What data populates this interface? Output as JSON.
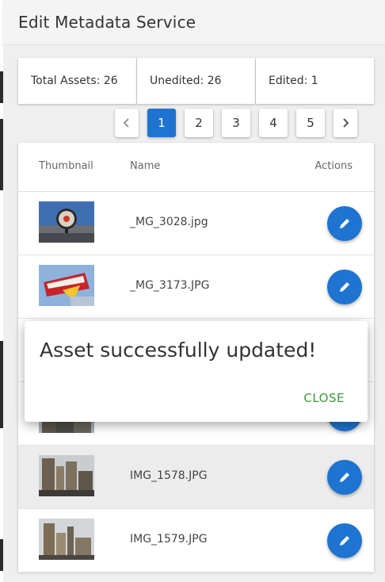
{
  "window": {
    "title": "Edit Metadata Service"
  },
  "stats": {
    "total": "Total Assets: 26",
    "unedited": "Unedited: 26",
    "edited": "Edited: 1"
  },
  "pagination": {
    "pages": [
      "1",
      "2",
      "3",
      "4",
      "5"
    ],
    "active": "1",
    "prev_icon": "chevron-left-icon",
    "next_icon": "chevron-right-icon"
  },
  "table": {
    "columns": {
      "thumbnail": "Thumbnail",
      "name": "Name",
      "actions": "Actions"
    },
    "rows": [
      {
        "name": "_MG_3028.jpg",
        "thumbnail": "clock-photo"
      },
      {
        "name": "_MG_3173.JPG",
        "thumbnail": "in-n-out-sign-photo"
      },
      {
        "name": "",
        "thumbnail": "city-photo"
      },
      {
        "name": "",
        "thumbnail": "city-photo"
      },
      {
        "name": "IMG_1578.JPG",
        "thumbnail": "city-photo"
      },
      {
        "name": "IMG_1579.JPG",
        "thumbnail": "city-photo"
      }
    ],
    "action_icon": "pencil-icon"
  },
  "toast": {
    "message": "Asset successfully updated!",
    "close_label": "CLOSE"
  },
  "colors": {
    "primary": "#1e74d0",
    "close_text": "#3c9a3c",
    "title_bar": "#f4f4f4"
  }
}
